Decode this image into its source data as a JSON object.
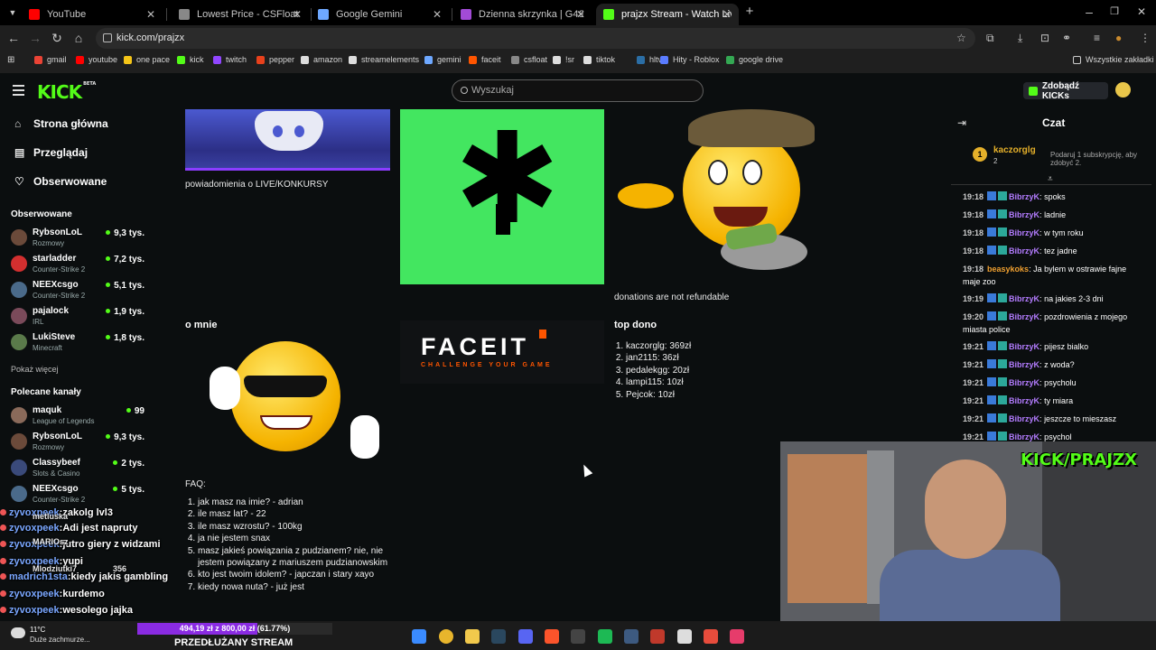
{
  "browser": {
    "tabs": [
      {
        "title": "YouTube",
        "color": "#ff0000"
      },
      {
        "title": "Lowest Price - CSFloat",
        "color": "#888888"
      },
      {
        "title": "Google Gemini",
        "color": "#6ea8ff"
      },
      {
        "title": "Dzienna skrzynka | G4Skins - O",
        "color": "#a24bd6"
      },
      {
        "title": "prajzx Stream - Watch Live on K",
        "color": "#53fc18"
      }
    ],
    "url": "kick.com/prajzx",
    "bookmarks": [
      {
        "label": "gmail",
        "color": "#ea4335"
      },
      {
        "label": "youtube",
        "color": "#ff0000"
      },
      {
        "label": "one pace",
        "color": "#f5c518"
      },
      {
        "label": "kick",
        "color": "#53fc18"
      },
      {
        "label": "twitch",
        "color": "#9146ff"
      },
      {
        "label": "pepper",
        "color": "#e8411c"
      },
      {
        "label": "amazon",
        "color": "#dddddd"
      },
      {
        "label": "streamelements",
        "color": "#dddddd"
      },
      {
        "label": "gemini",
        "color": "#6ea8ff"
      },
      {
        "label": "faceit",
        "color": "#ff5500"
      },
      {
        "label": "csfloat",
        "color": "#888888"
      },
      {
        "label": "!sr",
        "color": "#dddddd"
      },
      {
        "label": "tiktok",
        "color": "#dddddd"
      },
      {
        "label": "hltv",
        "color": "#2b6ea5"
      },
      {
        "label": "Hity - Roblox",
        "color": "#5a7cff"
      },
      {
        "label": "google drive",
        "color": "#34a853"
      }
    ],
    "all_bookmarks": "Wszystkie zakładki"
  },
  "header": {
    "logo": "KICK",
    "beta": "BETA",
    "search_placeholder": "Wyszukaj",
    "kicks_button": "Zdobądź KICKs"
  },
  "sidebar": {
    "nav": [
      {
        "label": "Strona główna",
        "icon": "home-icon"
      },
      {
        "label": "Przeglądaj",
        "icon": "browse-icon"
      },
      {
        "label": "Obserwowane",
        "icon": "heart-icon"
      }
    ],
    "followed_title": "Obserwowane",
    "followed": [
      {
        "name": "RybsonLoL",
        "category": "Rozmowy",
        "viewers": "9,3 tys.",
        "color": "#6b4a3a"
      },
      {
        "name": "starladder",
        "category": "Counter-Strike 2",
        "viewers": "7,2 tys.",
        "color": "#d32f2f"
      },
      {
        "name": "NEEXcsgo",
        "category": "Counter-Strike 2",
        "viewers": "5,1 tys.",
        "color": "#4a6a8a"
      },
      {
        "name": "pajalock",
        "category": "IRL",
        "viewers": "1,9 tys.",
        "color": "#7a4a5a"
      },
      {
        "name": "LukiSteve",
        "category": "Minecraft",
        "viewers": "1,8 tys.",
        "color": "#5a7a4a"
      }
    ],
    "show_more": "Pokaż więcej",
    "recommended_title": "Polecane kanały",
    "recommended": [
      {
        "name": "maquk",
        "category": "League of Legends",
        "viewers": "99",
        "color": "#8a6a5a"
      },
      {
        "name": "RybsonLoL",
        "category": "Rozmowy",
        "viewers": "9,3 tys.",
        "color": "#6b4a3a"
      },
      {
        "name": "Classybeef",
        "category": "Slots & Casino",
        "viewers": "2 tys.",
        "color": "#3a4a7a"
      },
      {
        "name": "NEEXcsgo",
        "category": "Counter-Strike 2",
        "viewers": "5 tys.",
        "color": "#4a6a8a"
      }
    ]
  },
  "overlay_chat": [
    {
      "user": "zyvoxpeek",
      "text": "zakolg lvl3"
    },
    {
      "user": "zyvoxpeek",
      "text": "Adi jest napruty"
    },
    {
      "user": "zyvoxpeek",
      "text": "jutro giery z widzami"
    },
    {
      "user": "zyvoxpeek",
      "text": "yupi"
    },
    {
      "user": "madrich1sta",
      "text": "kiedy jakis gambling"
    },
    {
      "user": "zyvoxpeek",
      "text": "kurdemo"
    },
    {
      "user": "zyvoxpeek",
      "text": "wesolego jajka"
    }
  ],
  "overlay_partial": [
    {
      "label": "metluska"
    },
    {
      "label": "MARIOsz"
    },
    {
      "label": "Mlodziutki7",
      "value": "356"
    }
  ],
  "panels": {
    "discord_caption": "powiadomienia o LIVE/KONKURSY",
    "donations_caption": "donations are not refundable",
    "about_title": "o mnie",
    "faceit_logo": "FACEIT",
    "faceit_tagline": "CHALLENGE YOUR GAME",
    "topdono_title": "top dono",
    "topdono": [
      "kaczorglg: 369zł",
      "jan2115: 36zł",
      "pedalekgg: 20zł",
      "lampi115: 10zł",
      "Pejcok: 10zł"
    ],
    "faq_title": "FAQ:",
    "faq": [
      "jak masz na imie? - adrian",
      "ile masz lat? - 22",
      "ile masz wzrostu? - 100kg",
      "ja nie jestem snax",
      "masz jakieś powiązania z pudzianem? nie, nie jestem powiązany z mariuszem pudzianowskim",
      "kto jest twoim idolem? - japczan i stary xayo",
      "kiedy nowa nuta? - już jest"
    ]
  },
  "chat": {
    "title": "Czat",
    "gifter": {
      "rank": "1",
      "name": "kaczorglg",
      "count": "2",
      "info": "Podaruj 1 subskrypcję, aby zdobyć 2."
    },
    "messages": [
      {
        "time": "19:18",
        "user": "BibrzyK",
        "text": "spoks"
      },
      {
        "time": "19:18",
        "user": "BibrzyK",
        "text": "ladnie"
      },
      {
        "time": "19:18",
        "user": "BibrzyK",
        "text": "w tym roku"
      },
      {
        "time": "19:18",
        "user": "BibrzyK",
        "text": "tez jadne"
      },
      {
        "time": "19:18",
        "user": "beasykoks",
        "text": "Ja bylem w ostrawie fajne maje zoo"
      },
      {
        "time": "19:19",
        "user": "BibrzyK",
        "text": "na jakies 2-3 dni"
      },
      {
        "time": "19:20",
        "user": "BibrzyK",
        "text": "pozdrowienia z mojego miasta police"
      },
      {
        "time": "19:21",
        "user": "BibrzyK",
        "text": "pijesz bialko"
      },
      {
        "time": "19:21",
        "user": "BibrzyK",
        "text": "z woda?"
      },
      {
        "time": "19:21",
        "user": "BibrzyK",
        "text": "psycholu"
      },
      {
        "time": "19:21",
        "user": "BibrzyK",
        "text": "ty miara"
      },
      {
        "time": "19:21",
        "user": "BibrzyK",
        "text": "jeszcze to mieszasz"
      },
      {
        "time": "19:21",
        "user": "BibrzyK",
        "text": "psychol"
      }
    ]
  },
  "webcam": {
    "tag": "KICK/PRAJZX"
  },
  "taskbar": {
    "weather_temp": "11°C",
    "weather_desc": "Duże zachmurze...",
    "goal_text": "494,19 zł z 800,00 zł (61.77%)",
    "goal_fraction": 0.6177,
    "goal_color": "#8a2be2",
    "extend_label": "PRZEDŁUŻANY STREAM",
    "apps": [
      {
        "name": "windows-start",
        "color": "#3a8bff"
      },
      {
        "name": "chrome",
        "color": "#e8b52c"
      },
      {
        "name": "explorer",
        "color": "#f2c94c"
      },
      {
        "name": "steam",
        "color": "#2a475e"
      },
      {
        "name": "discord",
        "color": "#5865f2"
      },
      {
        "name": "brave",
        "color": "#fb542b"
      },
      {
        "name": "obs",
        "color": "#444444"
      },
      {
        "name": "spotify",
        "color": "#1db954"
      },
      {
        "name": "app-blue",
        "color": "#3d5a80"
      },
      {
        "name": "app-red",
        "color": "#c0392b"
      },
      {
        "name": "app-tf",
        "color": "#dddddd"
      },
      {
        "name": "app-rec",
        "color": "#e74c3c"
      },
      {
        "name": "tiktok",
        "color": "#e63c6b"
      }
    ]
  }
}
